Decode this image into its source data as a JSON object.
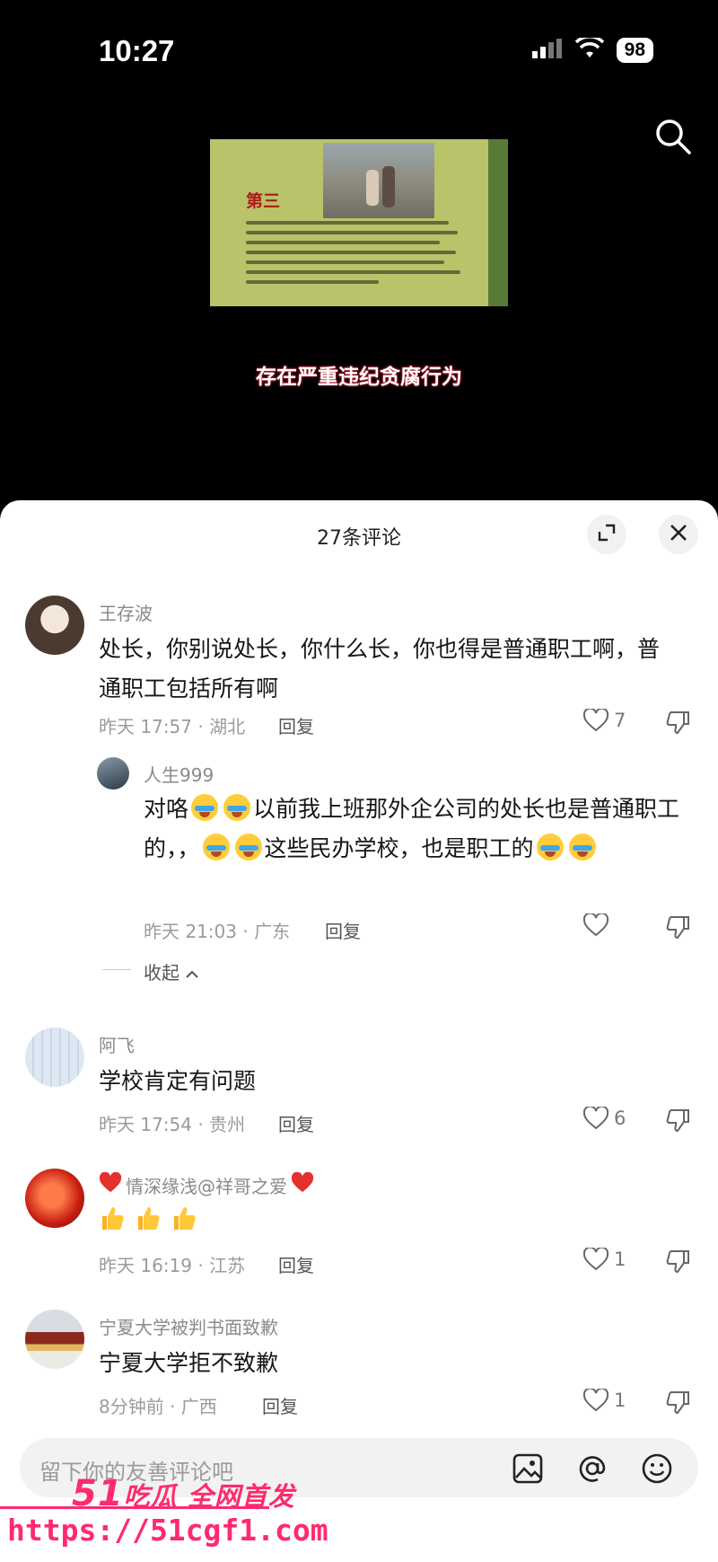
{
  "status": {
    "time": "10:27",
    "battery": "98"
  },
  "video": {
    "frame_heading": "第三",
    "caption": "存在严重违纪贪腐行为"
  },
  "sheet": {
    "title": "27条评论"
  },
  "comments": [
    {
      "name": "王存波",
      "text": "处长，你别说处长，你什么长，你也得是普通职工啊，普通职工包括所有啊",
      "time_loc": "昨天 17:57 · 湖北",
      "reply_label": "回复",
      "likes": "7"
    },
    {
      "name": "阿飞",
      "text": "学校肯定有问题",
      "time_loc": "昨天 17:54 · 贵州",
      "reply_label": "回复",
      "likes": "6"
    },
    {
      "name": "情深缘浅@祥哥之爱",
      "text": "",
      "time_loc": "昨天 16:19 · 江苏",
      "reply_label": "回复",
      "likes": "1"
    },
    {
      "name": "宁夏大学被判书面致歉",
      "text": "宁夏大学拒不致歉",
      "time_loc": "8分钟前 · 广西",
      "reply_label": "回复",
      "likes": "1"
    }
  ],
  "reply": {
    "name": "人生999",
    "text_part1": "对咯",
    "text_part2": "以前我上班那外企公司的处长也是普通职工的，，",
    "text_part3": "这些民办学校，也是职工的",
    "time_loc": "昨天 21:03 · 广东",
    "reply_label": "回复"
  },
  "collapse_label": "收起",
  "input": {
    "placeholder": "留下你的友善评论吧"
  },
  "watermark": {
    "logo_num": "51",
    "logo_text": "吃瓜 全网首发",
    "url": "https://51cgf1.com"
  },
  "colors": {
    "accent": "#ff2a6d",
    "background": "#000000",
    "sheet": "#ffffff"
  }
}
